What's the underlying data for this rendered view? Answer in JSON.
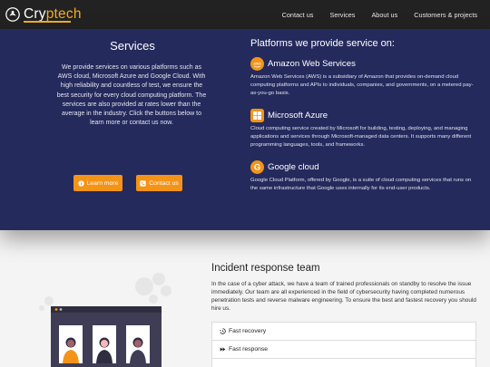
{
  "brand": {
    "part1": "Cry",
    "part2": "ptech"
  },
  "nav": [
    "Contact us",
    "Services",
    "About us",
    "Customers & projects"
  ],
  "services": {
    "title": "Services",
    "description": "We provide services on various platforms such as AWS cloud, Microsoft Azure and Google Cloud. With high reliability and countless of test, we ensure the best security for every cloud computing platform. The services are also provided at rates lower than the average in the industry. Click the buttons below to learn more or contact us now.",
    "learn_more": "Learn more",
    "contact": "Contact us"
  },
  "platforms": {
    "title": "Platforms we provide service on:",
    "aws": {
      "name": "Amazon Web Services",
      "icon_text": "aws",
      "desc": "Amazon Web Services (AWS) is a subsidiary of Amazon that provides on-demand cloud computing platforms and APIs to individuals, companies, and governments, on a metered pay-as-you-go basis."
    },
    "azure": {
      "name": "Microsoft Azure",
      "desc": "Cloud computing service created by Microsoft for building, testing, deploying, and managing applications and services through Microsoft-managed data centers. It supports many different programming languages, tools, and frameworks."
    },
    "google": {
      "name": "Google cloud",
      "icon_text": "G",
      "desc": "Google Cloud Platform, offered by Google, is a suite of cloud computing services that runs on the same infrastructure that Google uses internally for its end-user products."
    }
  },
  "incident": {
    "title": "Incident response team",
    "desc": "In the case of a cyber attack, we have a team of trained professionals on standby to resolve the issue immediately. Our team are all experienced in the field of cybersecurity having completed numerous penetration tests and reverse malware engineering. To ensure the best and fastest recovery you should hire us.",
    "items": [
      "Fast recovery",
      "Fast response"
    ]
  },
  "colors": {
    "hero": "#242a5c",
    "accent": "#f39419",
    "nav": "#222222"
  },
  "icons": {
    "learn_more": "info-icon",
    "contact": "phone-icon",
    "fast_recovery": "history-icon",
    "fast_response": "forward-icon"
  }
}
